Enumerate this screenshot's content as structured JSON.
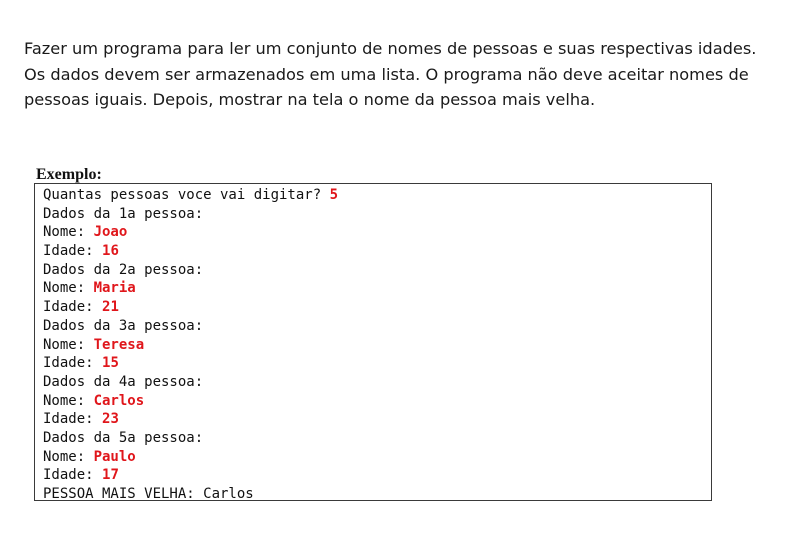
{
  "statement": {
    "lines": [
      "Fazer um programa para ler um conjunto de nomes de pessoas e suas respectivas idades.",
      "Os dados devem ser armazenados em uma lista. O programa não deve aceitar nomes de",
      "pessoas iguais. Depois, mostrar na tela o nome da pessoa mais velha."
    ]
  },
  "example": {
    "label": "Exemplo:",
    "console": [
      {
        "prompt": "Quantas pessoas voce vai digitar? ",
        "input": "5"
      },
      {
        "prompt": "Dados da 1a pessoa:",
        "input": ""
      },
      {
        "prompt": "Nome: ",
        "input": "Joao"
      },
      {
        "prompt": "Idade: ",
        "input": "16"
      },
      {
        "prompt": "Dados da 2a pessoa:",
        "input": ""
      },
      {
        "prompt": "Nome: ",
        "input": "Maria"
      },
      {
        "prompt": "Idade: ",
        "input": "21"
      },
      {
        "prompt": "Dados da 3a pessoa:",
        "input": ""
      },
      {
        "prompt": "Nome: ",
        "input": "Teresa"
      },
      {
        "prompt": "Idade: ",
        "input": "15"
      },
      {
        "prompt": "Dados da 4a pessoa:",
        "input": ""
      },
      {
        "prompt": "Nome: ",
        "input": "Carlos"
      },
      {
        "prompt": "Idade: ",
        "input": "23"
      },
      {
        "prompt": "Dados da 5a pessoa:",
        "input": ""
      },
      {
        "prompt": "Nome: ",
        "input": "Paulo"
      },
      {
        "prompt": "Idade: ",
        "input": "17"
      },
      {
        "prompt": "PESSOA MAIS VELHA: Carlos",
        "input": ""
      }
    ]
  },
  "colors": {
    "input_text": "#e0161b",
    "text": "#111111",
    "border": "#3a3a3a"
  }
}
